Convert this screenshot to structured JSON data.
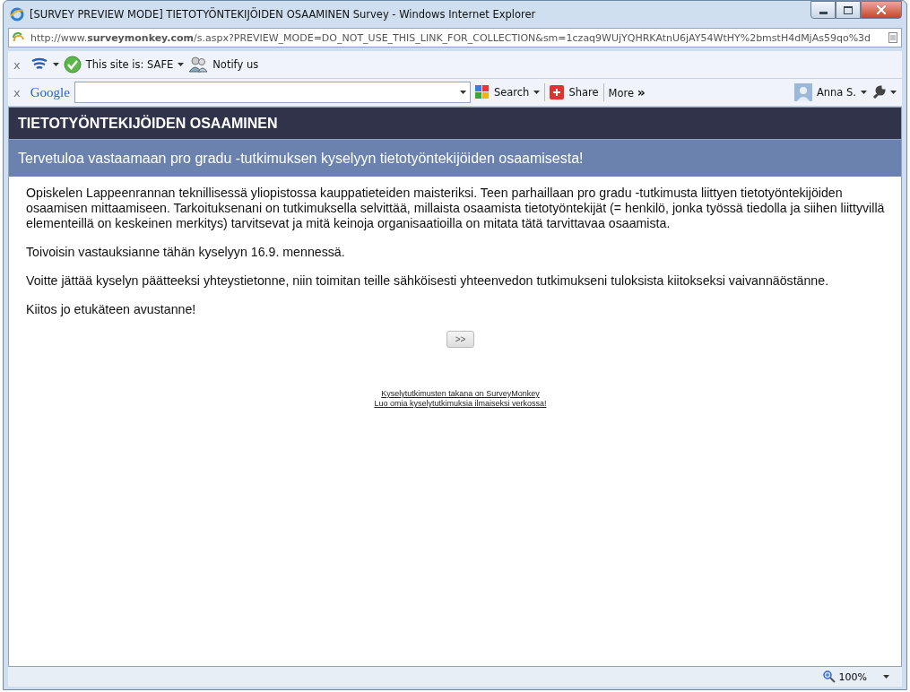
{
  "window": {
    "title": "[SURVEY PREVIEW MODE] TIETOTYÖNTEKIJÖIDEN OSAAMINEN Survey - Windows Internet Explorer"
  },
  "address_bar": {
    "url": "http://www.**surveymonkey.com**/s.aspx?PREVIEW_MODE=DO_NOT_USE_THIS_LINK_FOR_COLLECTION&sm=1czaq9WUjYQHRKAtnU6jAY54WtHY%2bmstH4dMjAs59qo%3d"
  },
  "toolbar_1": {
    "close": "x",
    "site_status": "This site is: SAFE",
    "notify": "Notify us"
  },
  "toolbar_2": {
    "close": "x",
    "logo": "Google",
    "search": "Search",
    "share": "Share",
    "more": "More",
    "more_arrows": "»",
    "user": "Anna S."
  },
  "survey": {
    "title": "TIETOTYÖNTEKIJÖIDEN OSAAMINEN",
    "page_title": "Tervetuloa vastaamaan pro gradu -tutkimuksen kyselyyn tietotyöntekijöiden osaamisesta!",
    "paragraphs": [
      "Opiskelen Lappeenrannan teknillisessä yliopistossa kauppatieteiden maisteriksi. Teen parhaillaan pro gradu -tutkimusta liittyen tietotyöntekijöiden osaamisen mittaamiseen. Tarkoituksenani on tutkimuksella selvittää, millaista osaamista tietotyöntekijät (= henkilö, jonka työssä tiedolla ja siihen liittyvillä elementeillä on keskeinen merkitys) tarvitsevat ja mitä keinoja organisaatioilla on mitata tätä tarvittavaa osaamista.",
      "Toivoisin vastauksianne tähän kyselyyn 16.9. mennessä.",
      "Voitte jättää kyselyn päätteeksi yhteystietonne, niin toimitan teille sähköisesti yhteenvedon tutkimukseni tuloksista kiitokseksi vaivannäöstänne.",
      "Kiitos jo etukäteen avustanne!"
    ],
    "next_button": ">>",
    "footer_links": [
      "Kyselytutkimusten takana on SurveyMonkey",
      "Luo omia kyselytutkimuksia ilmaiseksi verkossa!"
    ]
  },
  "status_bar": {
    "zoom": "100%"
  }
}
